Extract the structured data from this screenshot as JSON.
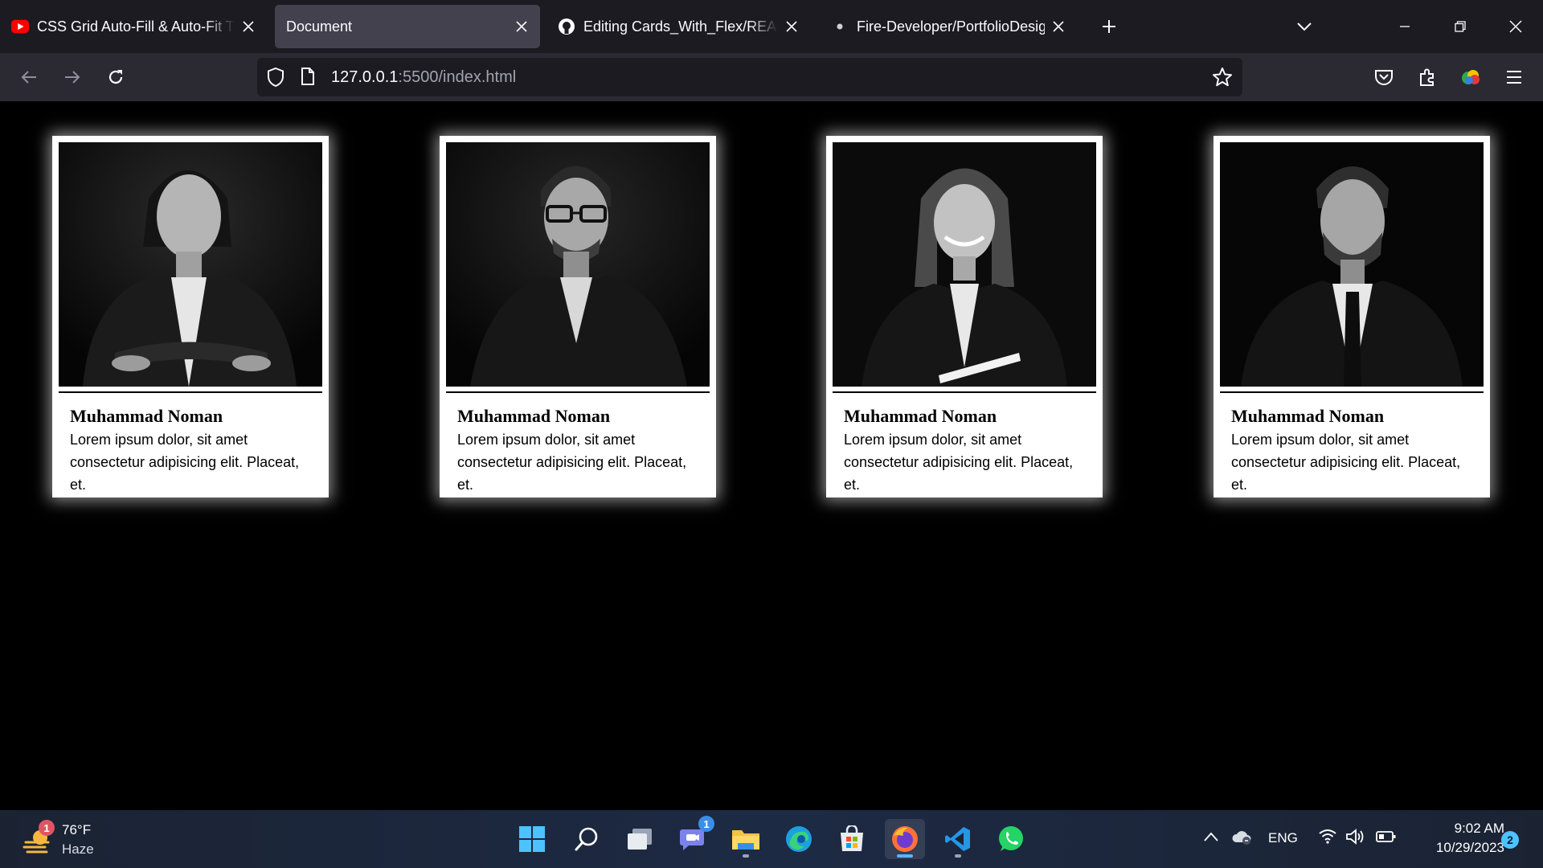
{
  "browser": {
    "tabs": [
      {
        "title": "CSS Grid Auto-Fill & Auto-Fit Tutorial",
        "favicon": "youtube-icon",
        "active": false
      },
      {
        "title": "Document",
        "favicon": "",
        "active": true
      },
      {
        "title": "Editing Cards_With_Flex/README.md",
        "favicon": "github-icon",
        "active": false
      },
      {
        "title": "Fire-Developer/PortfolioDesign",
        "favicon": "dot-icon",
        "active": false
      }
    ],
    "url_host": "127.0.0.1",
    "url_path": ":5500/index.html"
  },
  "cards": [
    {
      "name": "Muhammad Noman",
      "description": "Lorem ipsum dolor, sit amet consectetur adipisicing elit. Placeat, et.",
      "photo": "woman-portrait-arms-crossed"
    },
    {
      "name": "Muhammad Noman",
      "description": "Lorem ipsum dolor, sit amet consectetur adipisicing elit. Placeat, et.",
      "photo": "man-portrait-glasses"
    },
    {
      "name": "Muhammad Noman",
      "description": "Lorem ipsum dolor, sit amet consectetur adipisicing elit. Placeat, et.",
      "photo": "woman-portrait-smiling"
    },
    {
      "name": "Muhammad Noman",
      "description": "Lorem ipsum dolor, sit amet consectetur adipisicing elit. Placeat, et.",
      "photo": "man-portrait-bearded-tie"
    }
  ],
  "taskbar": {
    "weather": {
      "temp": "76°F",
      "condition": "Haze",
      "badge": "1"
    },
    "chat_badge": "1",
    "language": "ENG",
    "time": "9:02 AM",
    "date": "10/29/2023",
    "notifications": "2"
  },
  "colors": {
    "chrome_dark": "#1c1b22",
    "chrome_mid": "#2b2a33",
    "active_tab": "#42414d",
    "accent": "#0078d4"
  }
}
